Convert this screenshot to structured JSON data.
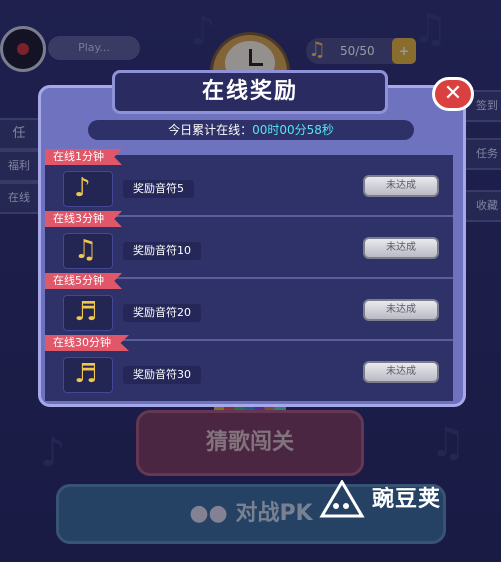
{
  "background": {
    "play_label": "Play...",
    "counter": "50/50",
    "counter_icon": "music-note-icon",
    "side_left": [
      "任",
      "福利",
      "在线"
    ],
    "side_right": [
      "签到",
      "任务",
      "收藏"
    ],
    "guess_button": "猜歌闯关",
    "pk_button": "对战PK",
    "watermark": "豌豆荚"
  },
  "dialog": {
    "title": "在线奖励",
    "online_label": "今日累计在线：",
    "online_time": "00时00分58秒",
    "close_icon": "close-icon",
    "rewards": [
      {
        "tag": "在线1分钟",
        "reward": "奖励音符5",
        "status": "未达成",
        "icon": "music-note-icon"
      },
      {
        "tag": "在线3分钟",
        "reward": "奖励音符10",
        "status": "未达成",
        "icon": "music-notes-icon"
      },
      {
        "tag": "在线5分钟",
        "reward": "奖励音符20",
        "status": "未达成",
        "icon": "music-notes-icon"
      },
      {
        "tag": "在线30分钟",
        "reward": "奖励音符30",
        "status": "未达成",
        "icon": "music-notes-icon"
      }
    ]
  },
  "colors": {
    "dialog_bg": "#6e72bf",
    "tag_red": "#e0576a",
    "time_cyan": "#57e4f3",
    "note_gold": "#f2c64e"
  }
}
